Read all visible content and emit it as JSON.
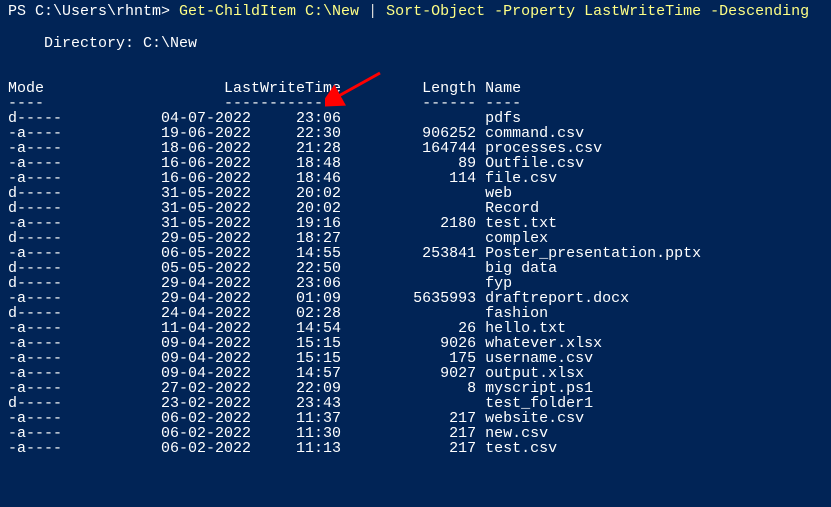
{
  "prompt": {
    "prefix": "PS C:\\Users\\rhntm> ",
    "command": "Get-ChildItem C:\\New ",
    "pipe": "| ",
    "sort_cmd": "Sort-Object -Property LastWriteTime -Descending"
  },
  "blank1": "",
  "directory_label": "    Directory: C:\\New",
  "blank2": "",
  "blank3": "",
  "headers": {
    "mode": "Mode",
    "lwt": "LastWriteTime",
    "length": "Length",
    "name": "Name"
  },
  "dashes": {
    "mode": "----",
    "lwt": "-------------",
    "length": "------",
    "name": "----"
  },
  "rows": [
    {
      "mode": "d-----",
      "date": "04-07-2022",
      "time": "23:06",
      "length": "",
      "name": "pdfs"
    },
    {
      "mode": "-a----",
      "date": "19-06-2022",
      "time": "22:30",
      "length": "906252",
      "name": "command.csv"
    },
    {
      "mode": "-a----",
      "date": "18-06-2022",
      "time": "21:28",
      "length": "164744",
      "name": "processes.csv"
    },
    {
      "mode": "-a----",
      "date": "16-06-2022",
      "time": "18:48",
      "length": "89",
      "name": "Outfile.csv"
    },
    {
      "mode": "-a----",
      "date": "16-06-2022",
      "time": "18:46",
      "length": "114",
      "name": "file.csv"
    },
    {
      "mode": "d-----",
      "date": "31-05-2022",
      "time": "20:02",
      "length": "",
      "name": "web"
    },
    {
      "mode": "d-----",
      "date": "31-05-2022",
      "time": "20:02",
      "length": "",
      "name": "Record"
    },
    {
      "mode": "-a----",
      "date": "31-05-2022",
      "time": "19:16",
      "length": "2180",
      "name": "test.txt"
    },
    {
      "mode": "d-----",
      "date": "29-05-2022",
      "time": "18:27",
      "length": "",
      "name": "complex"
    },
    {
      "mode": "-a----",
      "date": "06-05-2022",
      "time": "14:55",
      "length": "253841",
      "name": "Poster_presentation.pptx"
    },
    {
      "mode": "d-----",
      "date": "05-05-2022",
      "time": "22:50",
      "length": "",
      "name": "big data"
    },
    {
      "mode": "d-----",
      "date": "29-04-2022",
      "time": "23:06",
      "length": "",
      "name": "fyp"
    },
    {
      "mode": "-a----",
      "date": "29-04-2022",
      "time": "01:09",
      "length": "5635993",
      "name": "draftreport.docx"
    },
    {
      "mode": "d-----",
      "date": "24-04-2022",
      "time": "02:28",
      "length": "",
      "name": "fashion"
    },
    {
      "mode": "-a----",
      "date": "11-04-2022",
      "time": "14:54",
      "length": "26",
      "name": "hello.txt"
    },
    {
      "mode": "-a----",
      "date": "09-04-2022",
      "time": "15:15",
      "length": "9026",
      "name": "whatever.xlsx"
    },
    {
      "mode": "-a----",
      "date": "09-04-2022",
      "time": "15:15",
      "length": "175",
      "name": "username.csv"
    },
    {
      "mode": "-a----",
      "date": "09-04-2022",
      "time": "14:57",
      "length": "9027",
      "name": "output.xlsx"
    },
    {
      "mode": "-a----",
      "date": "27-02-2022",
      "time": "22:09",
      "length": "8",
      "name": "myscript.ps1"
    },
    {
      "mode": "d-----",
      "date": "23-02-2022",
      "time": "23:43",
      "length": "",
      "name": "test_folder1"
    },
    {
      "mode": "-a----",
      "date": "06-02-2022",
      "time": "11:37",
      "length": "217",
      "name": "website.csv"
    },
    {
      "mode": "-a----",
      "date": "06-02-2022",
      "time": "11:30",
      "length": "217",
      "name": "new.csv"
    },
    {
      "mode": "-a----",
      "date": "06-02-2022",
      "time": "11:13",
      "length": "217",
      "name": "test.csv"
    }
  ]
}
